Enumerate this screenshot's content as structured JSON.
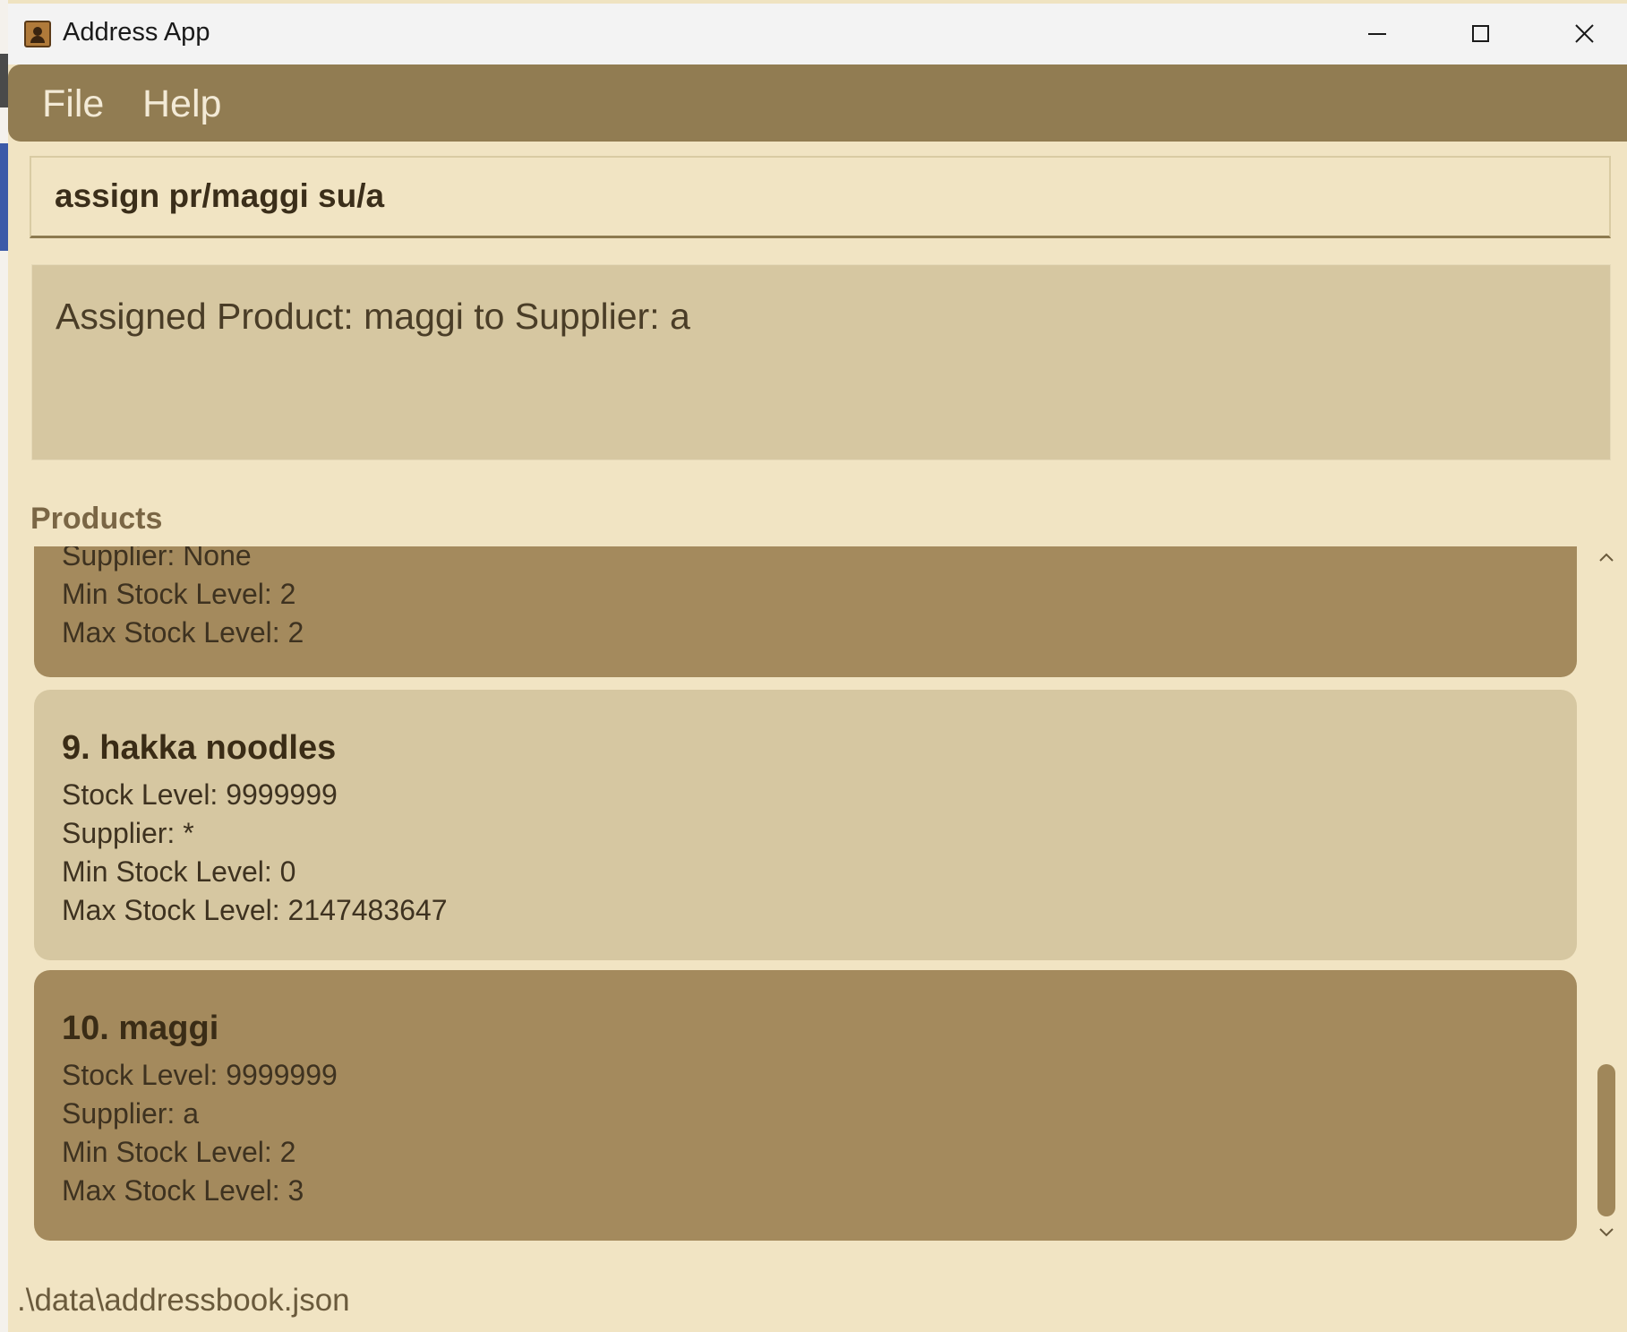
{
  "window": {
    "title": "Address App",
    "icon": "address-book-icon"
  },
  "window_controls": [
    "minimize-icon",
    "maximize-icon",
    "close-icon"
  ],
  "menu": {
    "items": [
      {
        "label": "File"
      },
      {
        "label": "Help"
      }
    ]
  },
  "command": {
    "value": "assign pr/maggi su/a"
  },
  "result": {
    "message": "Assigned Product: maggi to Supplier: a"
  },
  "products": {
    "label": "Products",
    "cards": [
      {
        "name": "",
        "lines": [
          "Supplier: None",
          "Min Stock Level: 2",
          "Max Stock Level: 2"
        ]
      },
      {
        "name": "9. hakka noodles",
        "lines": [
          "Stock Level: 9999999",
          "Supplier: *",
          "Min Stock Level: 0",
          "Max Stock Level: 2147483647"
        ]
      },
      {
        "name": "10. maggi",
        "lines": [
          "Stock Level: 9999999",
          "Supplier: a",
          "Min Stock Level: 2",
          "Max Stock Level: 3"
        ]
      }
    ]
  },
  "status": {
    "path": ".\\data\\addressbook.json"
  },
  "colors": {
    "menubar": "#917c52",
    "background": "#f1e4c3",
    "card_dark": "#a48a5d",
    "card_light": "#d6c7a1"
  }
}
